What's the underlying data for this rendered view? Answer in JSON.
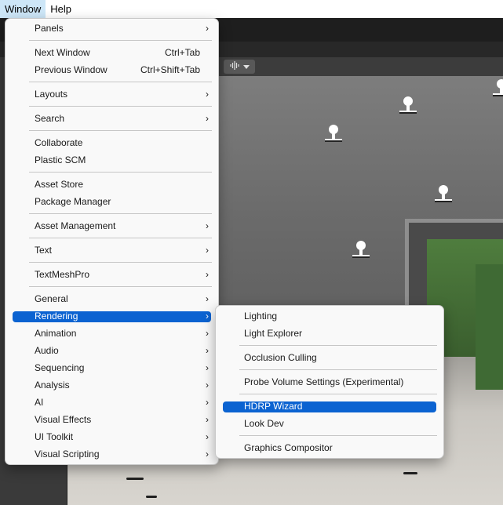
{
  "menubar": {
    "items": [
      {
        "label": "Window",
        "active": true
      },
      {
        "label": "Help",
        "active": false
      }
    ]
  },
  "scene_toolbar": {
    "audio_icon": "audio-wave-icon",
    "dropdown_icon": "chevron-down-icon"
  },
  "window_menu": {
    "items": [
      {
        "label": "Panels",
        "shortcut": "",
        "submenu": true
      },
      {
        "label": "Next Window",
        "shortcut": "Ctrl+Tab",
        "submenu": false
      },
      {
        "label": "Previous Window",
        "shortcut": "Ctrl+Shift+Tab",
        "submenu": false
      },
      {
        "label": "Layouts",
        "shortcut": "",
        "submenu": true
      },
      {
        "label": "Search",
        "shortcut": "",
        "submenu": true
      },
      {
        "label": "Collaborate",
        "shortcut": "",
        "submenu": false
      },
      {
        "label": "Plastic SCM",
        "shortcut": "",
        "submenu": false
      },
      {
        "label": "Asset Store",
        "shortcut": "",
        "submenu": false
      },
      {
        "label": "Package Manager",
        "shortcut": "",
        "submenu": false
      },
      {
        "label": "Asset Management",
        "shortcut": "",
        "submenu": true
      },
      {
        "label": "Text",
        "shortcut": "",
        "submenu": true
      },
      {
        "label": "TextMeshPro",
        "shortcut": "",
        "submenu": true
      },
      {
        "label": "General",
        "shortcut": "",
        "submenu": true
      },
      {
        "label": "Rendering",
        "shortcut": "",
        "submenu": true,
        "highlighted": true
      },
      {
        "label": "Animation",
        "shortcut": "",
        "submenu": true
      },
      {
        "label": "Audio",
        "shortcut": "",
        "submenu": true
      },
      {
        "label": "Sequencing",
        "shortcut": "",
        "submenu": true
      },
      {
        "label": "Analysis",
        "shortcut": "",
        "submenu": true
      },
      {
        "label": "AI",
        "shortcut": "",
        "submenu": true
      },
      {
        "label": "Visual Effects",
        "shortcut": "",
        "submenu": true
      },
      {
        "label": "UI Toolkit",
        "shortcut": "",
        "submenu": true
      },
      {
        "label": "Visual Scripting",
        "shortcut": "",
        "submenu": true
      }
    ],
    "arrow_glyph": "›"
  },
  "rendering_submenu": {
    "items": [
      {
        "label": "Lighting"
      },
      {
        "label": "Light Explorer"
      },
      {
        "label": "Occlusion Culling"
      },
      {
        "label": "Probe Volume Settings (Experimental)"
      },
      {
        "label": "HDRP Wizard",
        "highlighted": true
      },
      {
        "label": "Look Dev"
      },
      {
        "label": "Graphics Compositor"
      }
    ]
  },
  "colors": {
    "menu_bg": "#f9f9f9",
    "highlight": "#0b63d1",
    "menubar_active": "#cde6f7"
  }
}
